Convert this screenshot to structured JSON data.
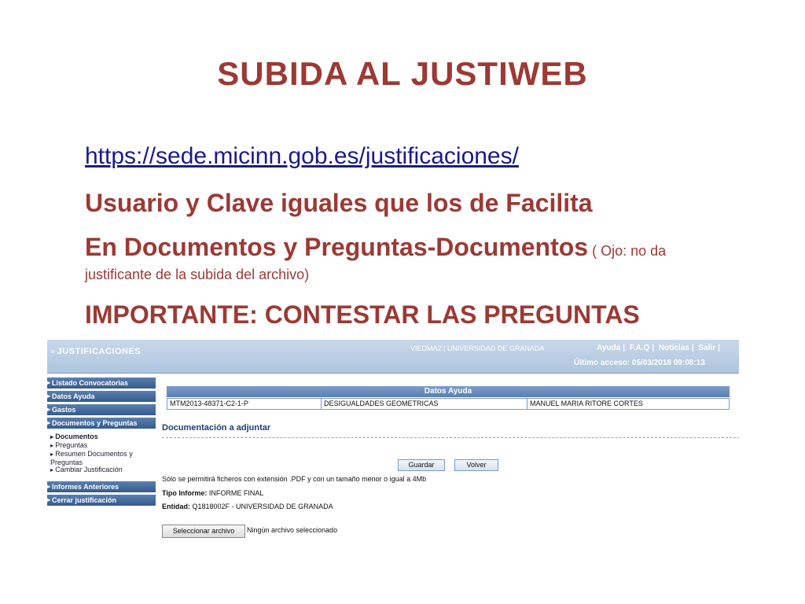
{
  "slide": {
    "title": "SUBIDA AL JUSTIWEB",
    "link": "https://sede.micinn.gob.es/justificaciones/",
    "line2": "Usuario y Clave iguales que los de Facilita",
    "line3_main": "En Documentos y Preguntas-Documentos",
    "line3_note1": " ( Ojo: no da",
    "line3_note2": "justificante de la subida del archivo)",
    "line4": "IMPORTANTE: CONTESTAR LAS PREGUNTAS",
    "colors": {
      "title": "#9b3a35",
      "link": "#1a1a8c"
    }
  },
  "app": {
    "brand": "JUSTIFICACIONES",
    "session": "VIEDMA2 | UNIVERSIDAD DE GRANADA",
    "top_links": [
      "Ayuda",
      "F.A.Q",
      "Noticias",
      "Salir"
    ],
    "last_access": "Último acceso: 05/03/2018 09:08:13",
    "sidebar": {
      "items": [
        "Listado Convocatorias",
        "Datos Ayuda",
        "Gastos",
        "Documentos y Preguntas",
        "Informes Anteriores",
        "Cerrar justificación"
      ],
      "subitems": [
        "Documentos",
        "Preguntas",
        "Resumen Documentos y Preguntas",
        "Cambiar Justificación"
      ],
      "active_subitem": "Documentos"
    },
    "datos_ayuda": {
      "header": "Datos Ayuda",
      "row": [
        "MTM2013-48371-C2-1-P",
        "DESIGUALDADES GEOMETRICAS",
        "MANUEL MARIA RITORE CORTES"
      ]
    },
    "doc_section_title": "Documentación a adjuntar",
    "buttons": {
      "save": "Guardar",
      "back": "Volver"
    },
    "notice": "Sólo se permitirá ficheros con extensión .PDF y con un tamaño menor o igual a 4Mb",
    "tipo_informe": {
      "label": "Tipo Informe:",
      "value": "INFORME FINAL"
    },
    "entidad": {
      "label": "Entidad:",
      "value": "Q1818002F - UNIVERSIDAD DE GRANADA"
    },
    "file_input": {
      "button": "Seleccionar archivo",
      "status": "Ningún archivo seleccionado"
    }
  }
}
